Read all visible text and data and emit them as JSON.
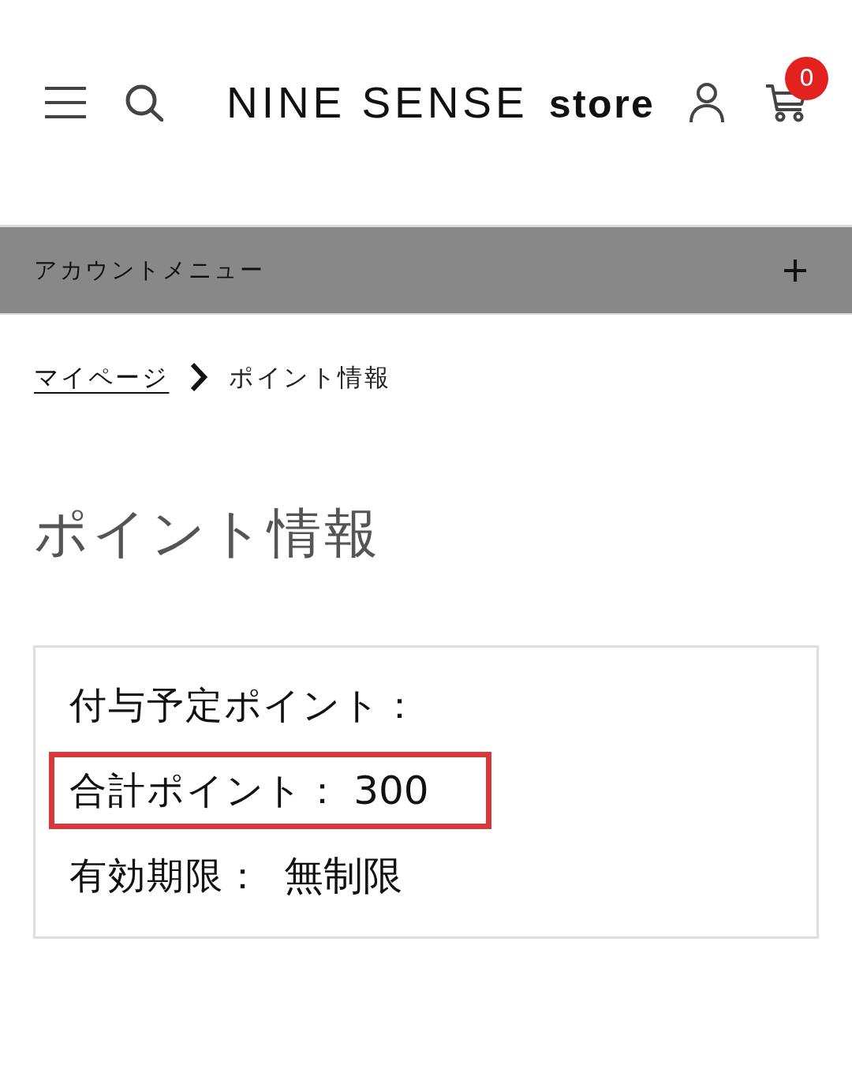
{
  "header": {
    "logo": {
      "name": "NINE SENSE",
      "suffix": "store"
    },
    "cart_count": "0"
  },
  "account_menu": {
    "label": "アカウントメニュー",
    "expanded": false
  },
  "breadcrumb": [
    {
      "label": "マイページ",
      "link": true
    },
    {
      "label": "ポイント情報",
      "link": false
    }
  ],
  "page_title": "ポイント情報",
  "points": [
    {
      "label": "付与予定ポイント：",
      "highlighted": false
    },
    {
      "label": "合計ポイント：",
      "value": "300",
      "highlighted": true
    },
    {
      "label": "有効期限：",
      "value": "無制限",
      "highlighted": false
    }
  ]
}
